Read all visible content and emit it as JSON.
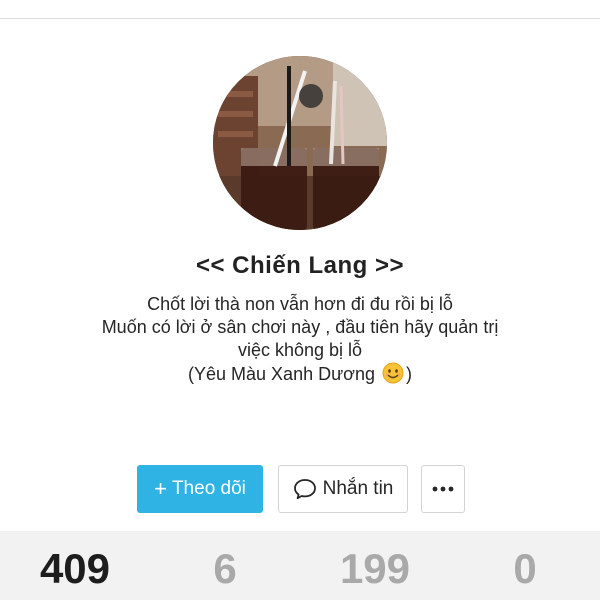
{
  "profile": {
    "display_name": "<< Chiến Lang >>",
    "bio_lines": [
      "Chốt lời thà non vẫn hơn đi đu rồi bị lỗ",
      "Muốn có lời ở sân chơi này , đầu tiên hãy quản trị",
      "việc không bị lỗ",
      "(Yêu Màu Xanh Dương",
      ")"
    ],
    "avatar_icon": "profile-photo",
    "bio_emoji": "smiling-face-emoji"
  },
  "actions": {
    "follow_icon": "plus-icon",
    "follow_label": "Theo dõi",
    "message_icon": "speech-bubble-icon",
    "message_label": "Nhắn tin",
    "more_icon": "more-dots-icon"
  },
  "stats": [
    {
      "value": "409",
      "label": ""
    },
    {
      "value": "6",
      "label": ""
    },
    {
      "value": "199",
      "label": ""
    },
    {
      "value": "0",
      "label": ""
    }
  ],
  "colors": {
    "accent": "#2fb3e4",
    "stat_primary": "#1d1d1d",
    "stat_muted": "#a9a9a9",
    "stats_background": "#f2f2f2"
  }
}
